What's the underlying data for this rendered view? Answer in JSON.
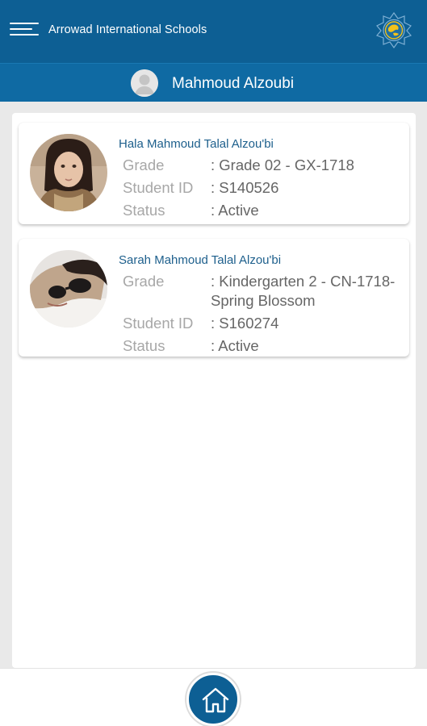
{
  "header": {
    "app_title": "Arrowad International Schools",
    "menu_icon": "hamburger-menu-icon",
    "logo_icon": "school-emblem-icon"
  },
  "user": {
    "name": "Mahmoud Alzoubi",
    "avatar_icon": "user-avatar-icon"
  },
  "students": [
    {
      "name": "Hala Mahmoud Talal Alzou'bi",
      "grade_label": "Grade",
      "grade_value": ": Grade 02 - GX-1718",
      "id_label": "Student ID",
      "id_value": ": S140526",
      "status_label": "Status",
      "status_value": ": Active"
    },
    {
      "name": "Sarah Mahmoud Talal Alzou'bi",
      "grade_label": "Grade",
      "grade_value": ": Kindergarten 2 - CN-1718-Spring Blossom",
      "id_label": "Student ID",
      "id_value": ": S160274",
      "status_label": "Status",
      "status_value": ": Active"
    }
  ],
  "footer": {
    "home_icon": "home-icon"
  },
  "colors": {
    "primary": "#0d5f94",
    "header_secondary": "#0f6aa3",
    "student_name": "#1d5f8c",
    "label": "#a7a7a7",
    "value": "#666666"
  }
}
